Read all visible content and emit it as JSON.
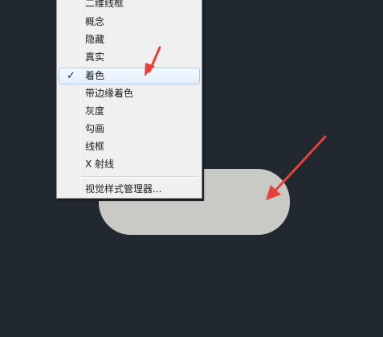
{
  "menu": {
    "items": [
      {
        "label": "二维线框",
        "checked": false
      },
      {
        "label": "概念",
        "checked": false
      },
      {
        "label": "隐藏",
        "checked": false
      },
      {
        "label": "真实",
        "checked": false
      },
      {
        "label": "着色",
        "checked": true
      },
      {
        "label": "带边缘着色",
        "checked": false
      },
      {
        "label": "灰度",
        "checked": false
      },
      {
        "label": "勾画",
        "checked": false
      },
      {
        "label": "线框",
        "checked": false
      },
      {
        "label": "X 射线",
        "checked": false
      }
    ],
    "check_mark": "✓",
    "manager_label": "视觉样式管理器..."
  },
  "colors": {
    "viewport_background": "#212830",
    "shape_fill": "#c9cac5",
    "annotation_arrow": "#e8413c"
  }
}
